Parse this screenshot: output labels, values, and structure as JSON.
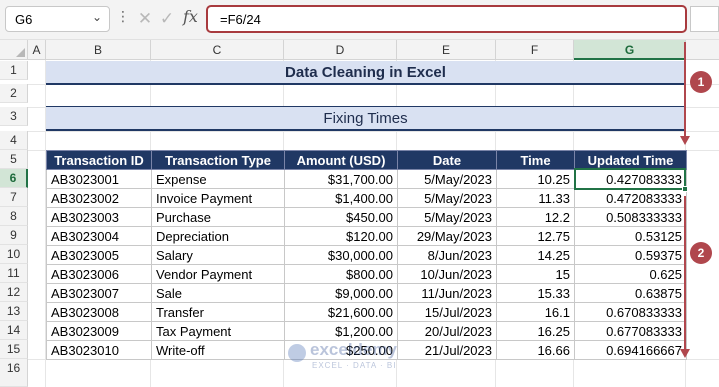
{
  "formula_bar": {
    "name_box": "G6",
    "name_box_arrow": "⌄",
    "more_icon": "⋮",
    "cancel_icon": "✕",
    "enter_icon": "✓",
    "fx_label": "fx",
    "formula": "=F6/24"
  },
  "columns": [
    "A",
    "B",
    "C",
    "D",
    "E",
    "F",
    "G"
  ],
  "rows": [
    "1",
    "2",
    "3",
    "4",
    "5",
    "6",
    "7",
    "8",
    "9",
    "10",
    "11",
    "12",
    "13",
    "14",
    "15",
    "16"
  ],
  "selected_column": "G",
  "selected_row": "6",
  "title": "Data Cleaning in Excel",
  "subtitle": "Fixing Times",
  "table": {
    "headers": [
      "Transaction ID",
      "Transaction Type",
      "Amount (USD)",
      "Date",
      "Time",
      "Updated Time"
    ],
    "rows": [
      [
        "AB3023001",
        "Expense",
        "$31,700.00",
        "5/May/2023",
        "10.25",
        "0.427083333"
      ],
      [
        "AB3023002",
        "Invoice Payment",
        "$1,400.00",
        "5/May/2023",
        "11.33",
        "0.472083333"
      ],
      [
        "AB3023003",
        "Purchase",
        "$450.00",
        "5/May/2023",
        "12.2",
        "0.508333333"
      ],
      [
        "AB3023004",
        "Depreciation",
        "$120.00",
        "29/May/2023",
        "12.75",
        "0.53125"
      ],
      [
        "AB3023005",
        "Salary",
        "$30,000.00",
        "8/Jun/2023",
        "14.25",
        "0.59375"
      ],
      [
        "AB3023006",
        "Vendor Payment",
        "$800.00",
        "10/Jun/2023",
        "15",
        "0.625"
      ],
      [
        "AB3023007",
        "Sale",
        "$9,000.00",
        "11/Jun/2023",
        "15.33",
        "0.63875"
      ],
      [
        "AB3023008",
        "Transfer",
        "$21,600.00",
        "15/Jul/2023",
        "16.1",
        "0.670833333"
      ],
      [
        "AB3023009",
        "Tax Payment",
        "$1,200.00",
        "20/Jul/2023",
        "16.25",
        "0.677083333"
      ],
      [
        "AB3023010",
        "Write-off",
        "$250.00",
        "21/Jul/2023",
        "16.66",
        "0.694166667"
      ]
    ]
  },
  "annotations": {
    "badge_1": "1",
    "badge_2": "2"
  },
  "watermark": {
    "name": "exceldemy",
    "tagline": "EXCEL · DATA · BI"
  },
  "colors": {
    "accent_red": "#b0474d",
    "header_navy": "#203864",
    "title_fill": "#d9e1f2",
    "selection_green": "#217346"
  }
}
